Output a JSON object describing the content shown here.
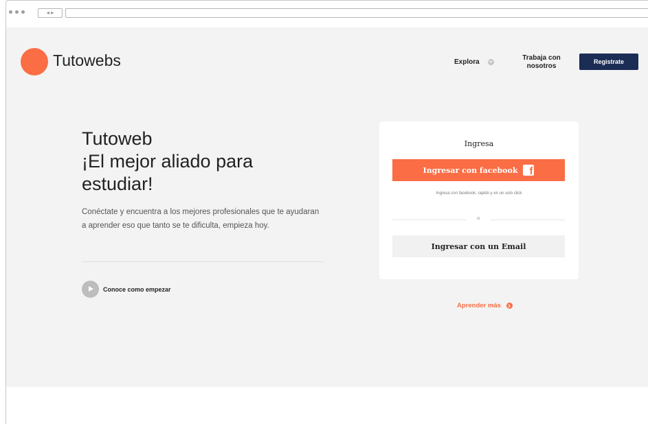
{
  "browser": {
    "nav_arrows": "◂ ▸"
  },
  "header": {
    "brand": "Tutowebs",
    "nav_explora": "Explora",
    "nav_trabaja_line1": "Trabaja con",
    "nav_trabaja_line2": "nosotros",
    "register_label": "Registrate"
  },
  "hero": {
    "title_line1": "Tutoweb",
    "title_line2": "¡El mejor aliado para",
    "title_line3": "estudiar!",
    "description": "Conéctate y encuentra a los mejores profesionales que te ayudaran a aprender eso que tanto se te dificulta, empieza hoy.",
    "play_label": "Conoce como empezar"
  },
  "login_card": {
    "title": "Ingresa",
    "facebook_label": "Ingresar con facebook",
    "facebook_hint": "Ingresa con facebook, rapido y en un solo click",
    "separator": "or",
    "email_label": "Ingresar con un Email"
  },
  "learn_more": {
    "label": "Aprender más"
  },
  "colors": {
    "accent": "#fb6d45",
    "navy": "#1b2c55",
    "page_bg": "#f3f3f3"
  },
  "icons": [
    "chevron-down-icon",
    "play-icon",
    "facebook-icon",
    "arrow-right-circle-icon"
  ]
}
